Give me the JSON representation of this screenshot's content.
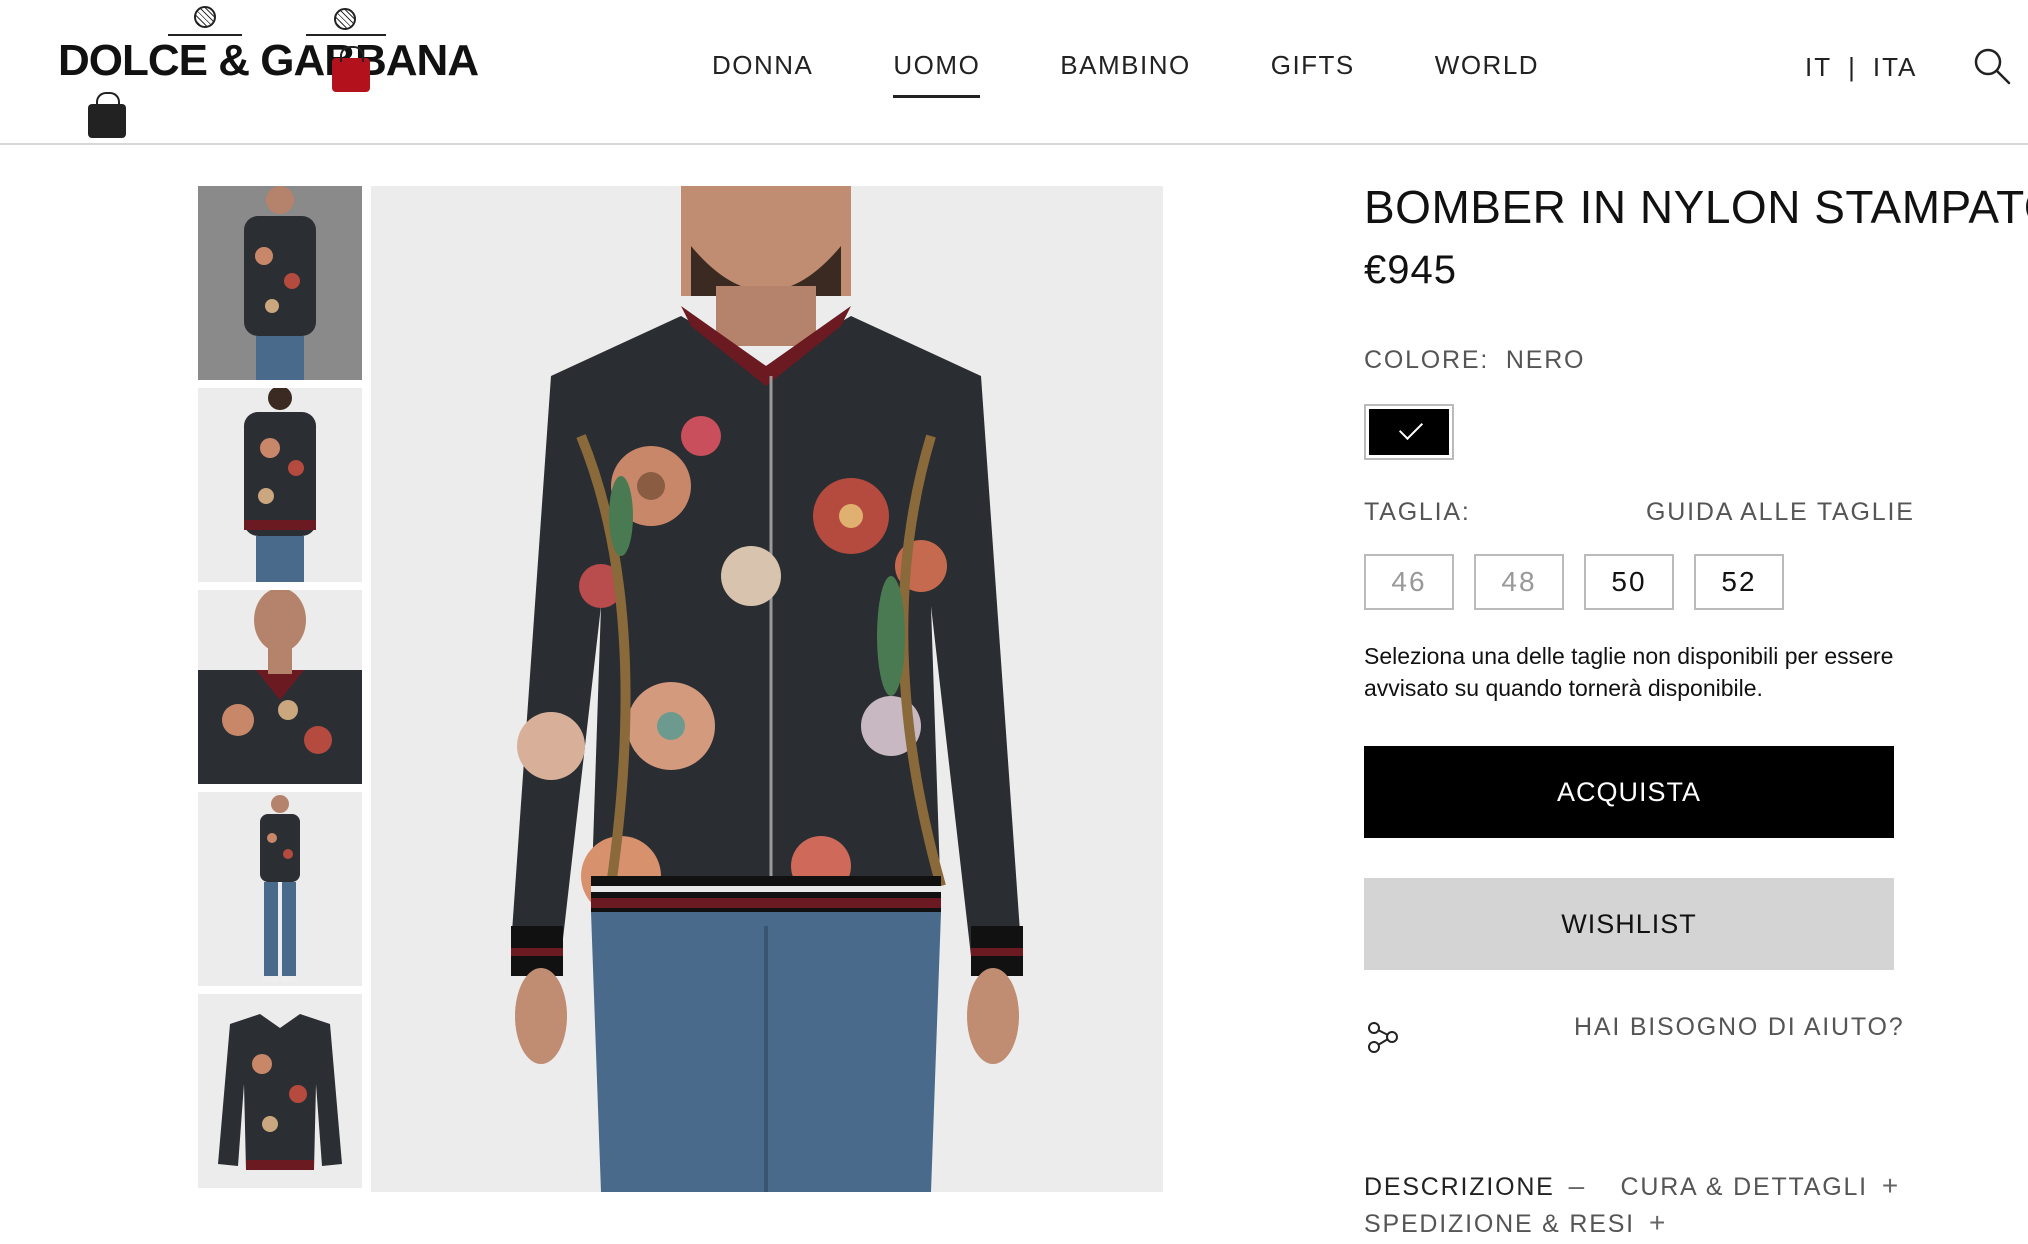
{
  "header": {
    "logo_text": "DOLCE & GABBANA",
    "nav": [
      {
        "label": "DONNA",
        "active": false
      },
      {
        "label": "UOMO",
        "active": true
      },
      {
        "label": "BAMBINO",
        "active": false
      },
      {
        "label": "GIFTS",
        "active": false
      },
      {
        "label": "WORLD",
        "active": false
      }
    ],
    "lang": {
      "country": "IT",
      "separator": "|",
      "language": "ITA"
    },
    "search_icon": "search-icon"
  },
  "gallery": {
    "thumbnails": [
      "front view",
      "back view",
      "close-up",
      "full length",
      "flat lay"
    ],
    "selected_index": 0
  },
  "product": {
    "title": "BOMBER IN NYLON STAMPATO",
    "price": "€945",
    "color_label": "COLORE:",
    "color_value": "NERO",
    "color_swatch": "#000000",
    "size_label": "TAGLIA:",
    "size_guide": "GUIDA ALLE TAGLIE",
    "sizes": [
      {
        "label": "46",
        "available": false
      },
      {
        "label": "48",
        "available": false
      },
      {
        "label": "50",
        "available": true
      },
      {
        "label": "52",
        "available": true
      }
    ],
    "note": "Seleziona una delle taglie non disponibili per essere avvisato su quando tornerà disponibile.",
    "buy_label": "ACQUISTA",
    "wishlist_label": "WISHLIST",
    "help_label": "HAI BISOGNO DI AIUTO?",
    "tabs": [
      {
        "label": "DESCRIZIONE",
        "symbol": "–"
      },
      {
        "label": "CURA & DETTAGLI",
        "symbol": "+"
      },
      {
        "label": "SPEDIZIONE & RESI",
        "symbol": "+"
      }
    ]
  },
  "colors": {
    "buy_bg": "#000000",
    "wishlist_bg": "#d4d4d4",
    "divider": "#d8d8d8"
  }
}
